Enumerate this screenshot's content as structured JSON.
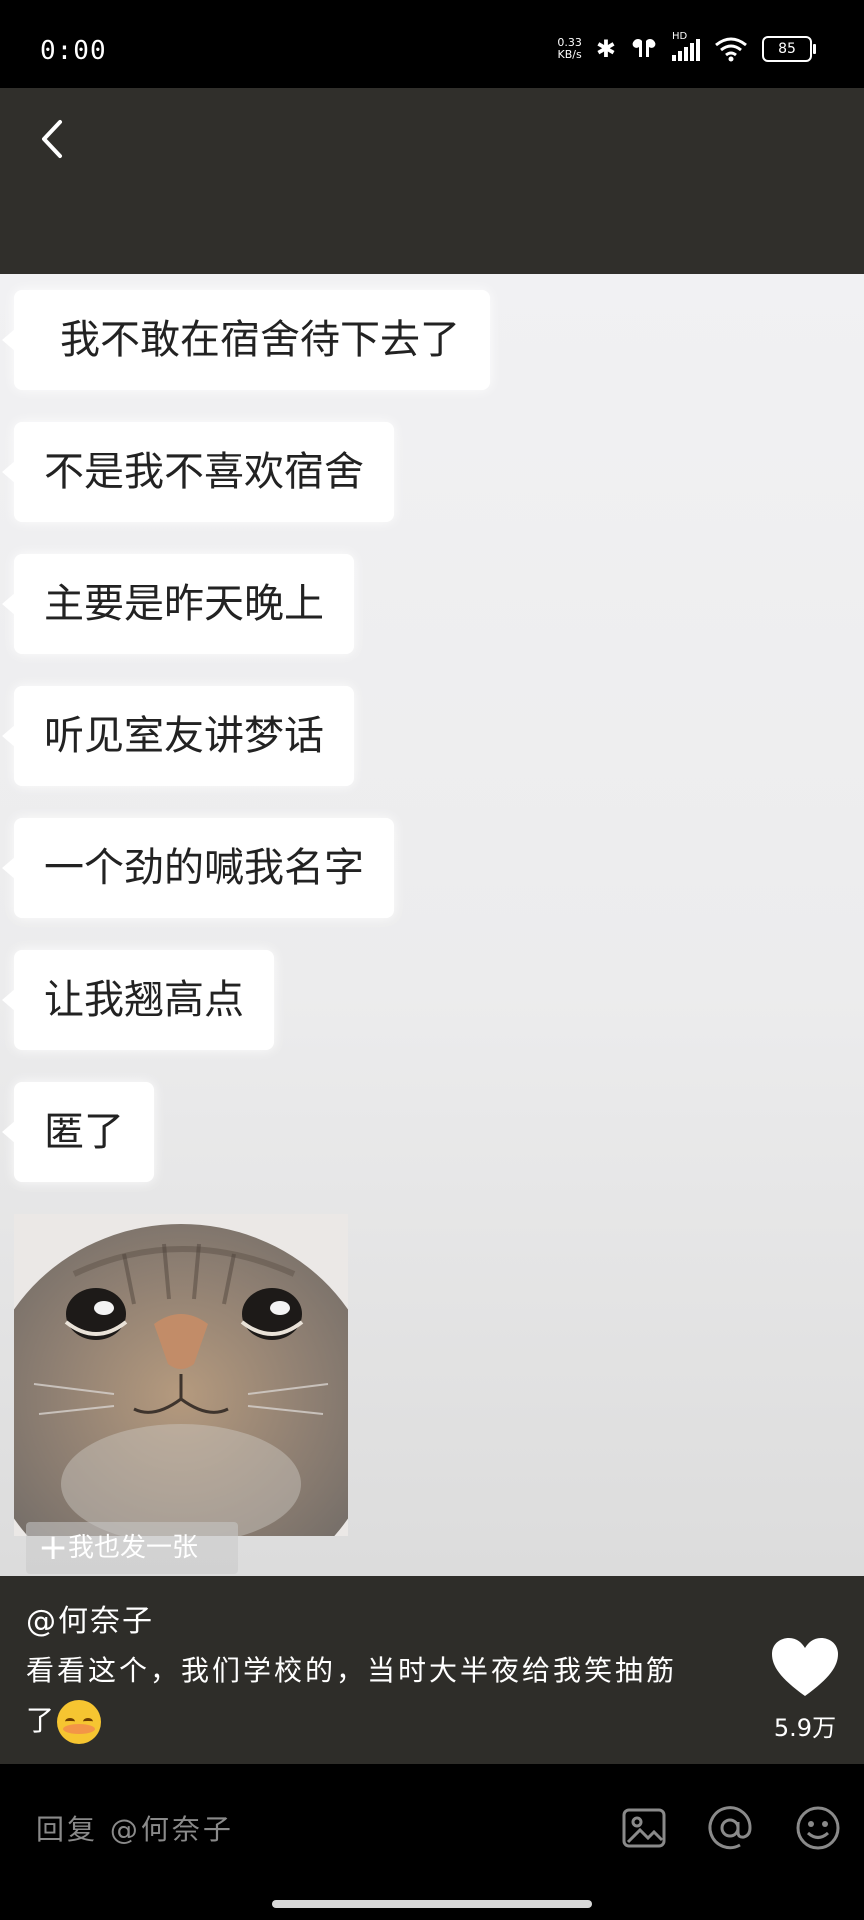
{
  "status_bar": {
    "time": "0:00",
    "net_speed_value": "0.33",
    "net_speed_unit": "KB/s",
    "battery": "85",
    "network_label": "HD"
  },
  "messages": [
    "我不敢在宿舍待下去了",
    "不是我不喜欢宿舍",
    "主要是昨天晚上",
    "听见室友讲梦话",
    "一个劲的喊我名字",
    "让我翘高点",
    "匿了"
  ],
  "me_too_label": "我也发一张",
  "post": {
    "author": "@何奈子",
    "caption": "看看这个，我们学校的，当时大半夜给我笑抽筋了",
    "like_count": "5.9万"
  },
  "reply": {
    "placeholder": "回复 @何奈子"
  },
  "icons": {
    "back": "back-arrow-icon",
    "like": "heart-icon",
    "image": "image-icon",
    "mention": "at-icon",
    "emoji": "smiley-icon"
  }
}
